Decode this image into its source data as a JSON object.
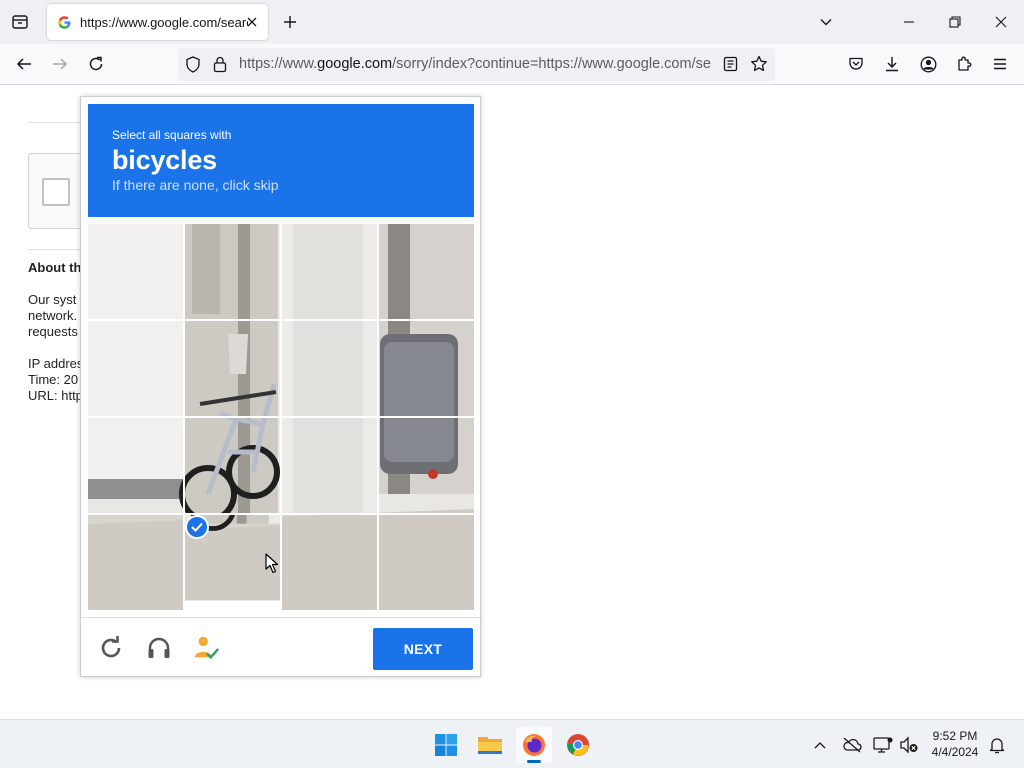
{
  "browser": {
    "tab": {
      "title": "https://www.google.com/search",
      "favicon": "google-g-icon"
    },
    "url": {
      "prefix": "https://www.",
      "host": "google.com",
      "rest": "/sorry/index?continue=https://www.google.com/search"
    },
    "colors": {
      "toolbar": "#f0f0f4",
      "navbar": "#f9f9fb"
    }
  },
  "page": {
    "about_heading": "About th",
    "about_lines": [
      "Our syst",
      "network.",
      "requests"
    ],
    "ip_label": "IP addres",
    "time_label": "Time: 20",
    "url_label": "URL: http"
  },
  "challenge": {
    "instruction": "Select all squares with",
    "target": "bicycles",
    "hint": "If there are none, click skip",
    "next_label": "NEXT",
    "accent": "#1a73e8",
    "grid": {
      "rows": 4,
      "cols": 4,
      "selected_tiles": [
        13
      ]
    },
    "footer_icons": [
      "reload-icon",
      "audio-headphones-icon",
      "info-person-check-icon"
    ]
  },
  "taskbar": {
    "time": "9:52 PM",
    "date": "4/4/2024",
    "apps": [
      "windows-start-icon",
      "file-explorer-icon",
      "firefox-icon",
      "chrome-icon"
    ],
    "tray": [
      "chevron-up-icon",
      "onedrive-offline-icon",
      "network-display-icon",
      "volume-muted-icon",
      "notification-bell-icon"
    ]
  }
}
